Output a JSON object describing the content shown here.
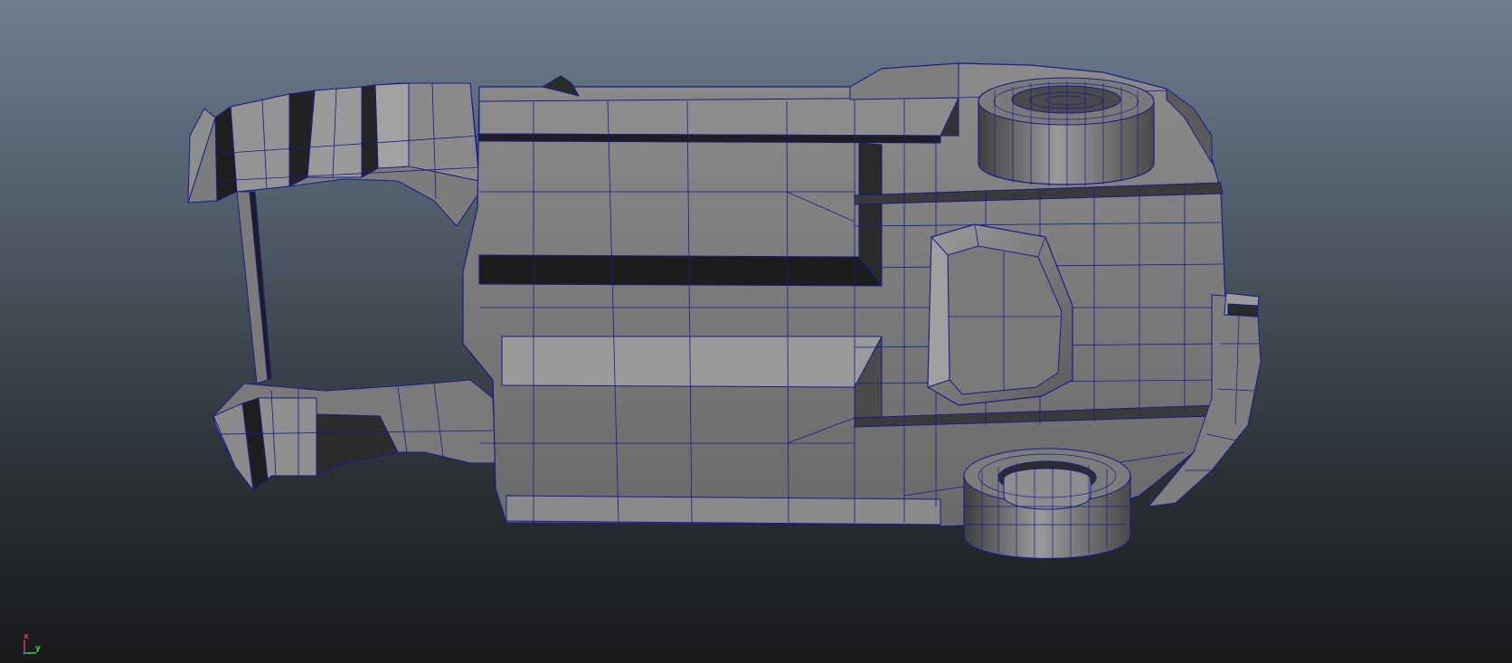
{
  "viewport": {
    "background_top": "#6e7e8f",
    "background_bottom": "#17191b",
    "wireframe_color": "#1a1a8a",
    "mesh_face_color": "#8a8a8a",
    "mesh_dark_color": "#2a2a2a"
  },
  "axis_gizmo": {
    "x_label": "x",
    "y_label": "y",
    "x_color": "#e04040",
    "y_color": "#40d040"
  },
  "model": {
    "type": "polygon-mesh-car-underside",
    "parts": [
      "car-body",
      "front-left-wheel",
      "front-right-wheel",
      "fuel-tank",
      "rear-frame-upper",
      "rear-frame-lower",
      "bumper"
    ]
  }
}
